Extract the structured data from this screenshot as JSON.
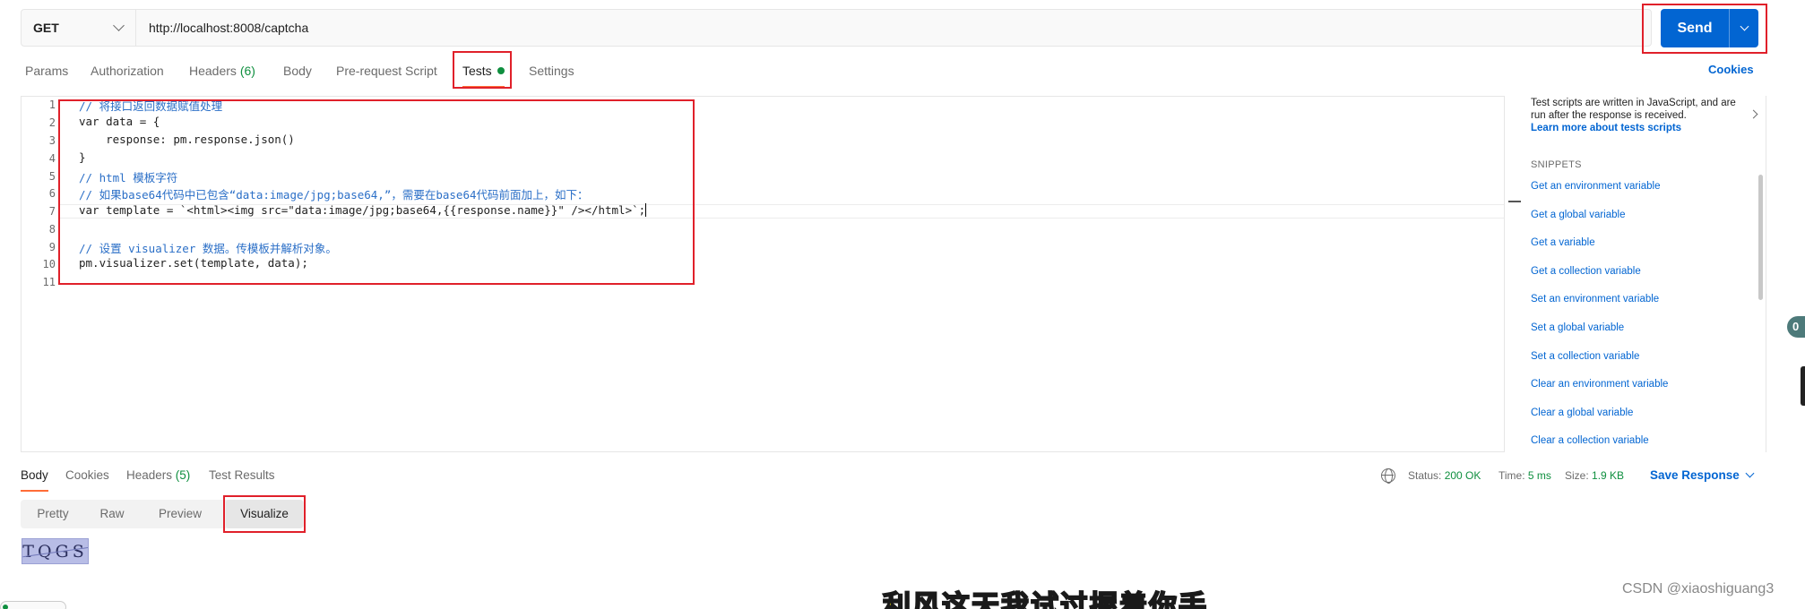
{
  "request": {
    "method": "GET",
    "url": "http://localhost:8008/captcha",
    "send_label": "Send"
  },
  "tabs": [
    {
      "label": "Params"
    },
    {
      "label": "Authorization"
    },
    {
      "label": "Headers",
      "count": "(6)"
    },
    {
      "label": "Body"
    },
    {
      "label": "Pre-request Script"
    },
    {
      "label": "Tests",
      "active": true
    },
    {
      "label": "Settings"
    }
  ],
  "cookies_label": "Cookies",
  "editor": {
    "line_numbers": [
      "1",
      "2",
      "3",
      "4",
      "5",
      "6",
      "7",
      "8",
      "9",
      "10",
      "11"
    ],
    "lines": [
      "// 将接口返回数据赋值处理",
      "var data = {",
      "    response: pm.response.json()",
      "}",
      "// html 模板字符",
      "// 如果base64代码中已包含“data:image/jpg;base64,”，需要在base64代码前面加上，如下：",
      "var template = `<html><img src=\"data:image/jpg;base64,{{response.name}}\" /></html>`;",
      "",
      "// 设置 visualizer 数据。传模板并解析对象。",
      "pm.visualizer.set(template, data);",
      ""
    ]
  },
  "side_panel": {
    "description": "Test scripts are written in JavaScript, and are run after the response is received.",
    "learn_link": "Learn more about tests scripts",
    "snippets_title": "SNIPPETS",
    "snippets": [
      "Get an environment variable",
      "Get a global variable",
      "Get a variable",
      "Get a collection variable",
      "Set an environment variable",
      "Set a global variable",
      "Set a collection variable",
      "Clear an environment variable",
      "Clear a global variable",
      "Clear a collection variable"
    ]
  },
  "response": {
    "tabs": [
      {
        "label": "Body",
        "active": true
      },
      {
        "label": "Cookies"
      },
      {
        "label": "Headers",
        "count": "(5)"
      },
      {
        "label": "Test Results"
      }
    ],
    "status_label": "Status:",
    "status_value": "200 OK",
    "time_label": "Time:",
    "time_value": "5 ms",
    "size_label": "Size:",
    "size_value": "1.9 KB",
    "save_label": "Save Response",
    "view_modes": [
      "Pretty",
      "Raw",
      "Preview",
      "Visualize"
    ],
    "active_view": "Visualize",
    "captcha_text": "TQGS"
  },
  "badge_text": "0",
  "video_subtitle": "利风这天我试过握着你手",
  "watermark": "CSDN @xiaoshiguang3",
  "colors": {
    "accent": "#ff6c37",
    "link": "#0265d2",
    "success": "#0f8f3f",
    "highlight_box": "#e0202a"
  }
}
